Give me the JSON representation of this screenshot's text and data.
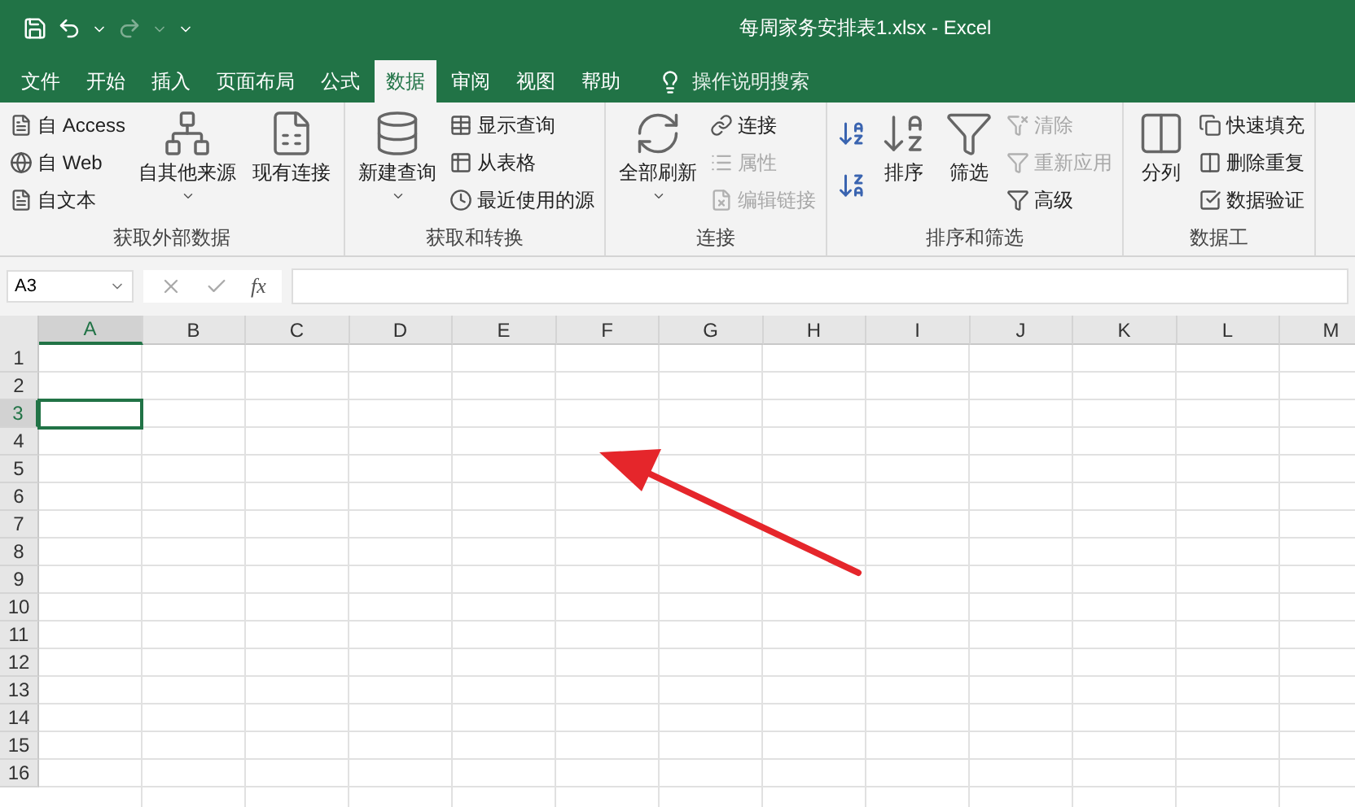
{
  "window": {
    "title": "每周家务安排表1.xlsx  -  Excel"
  },
  "tabs": [
    {
      "label": "文件",
      "selected": false
    },
    {
      "label": "开始",
      "selected": false
    },
    {
      "label": "插入",
      "selected": false
    },
    {
      "label": "页面布局",
      "selected": false
    },
    {
      "label": "公式",
      "selected": false
    },
    {
      "label": "数据",
      "selected": true
    },
    {
      "label": "审阅",
      "selected": false
    },
    {
      "label": "视图",
      "selected": false
    },
    {
      "label": "帮助",
      "selected": false
    }
  ],
  "search": {
    "placeholder": "操作说明搜索"
  },
  "ribbon": [
    {
      "label": "获取外部数据",
      "items": [
        {
          "kind": "stack",
          "items": [
            {
              "label": "自 Access",
              "disabled": false
            },
            {
              "label": "自 Web",
              "disabled": false
            },
            {
              "label": "自文本",
              "disabled": false
            }
          ]
        },
        {
          "kind": "large",
          "label": "自其他来源",
          "dropdown": true
        },
        {
          "kind": "large",
          "label": "现有连接",
          "dropdown": false
        }
      ]
    },
    {
      "label": "获取和转换",
      "items": [
        {
          "kind": "large",
          "label": "新建查询",
          "dropdown": true
        },
        {
          "kind": "stack",
          "items": [
            {
              "label": "显示查询",
              "disabled": false
            },
            {
              "label": "从表格",
              "disabled": false
            },
            {
              "label": "最近使用的源",
              "disabled": false
            }
          ]
        }
      ]
    },
    {
      "label": "连接",
      "items": [
        {
          "kind": "large",
          "label": "全部刷新",
          "dropdown": true
        },
        {
          "kind": "stack",
          "items": [
            {
              "label": "连接",
              "disabled": false
            },
            {
              "label": "属性",
              "disabled": true
            },
            {
              "label": "编辑链接",
              "disabled": true
            }
          ]
        }
      ]
    },
    {
      "label": "排序和筛选",
      "items": [
        {
          "kind": "sorticons"
        },
        {
          "kind": "large",
          "label": "排序",
          "dropdown": false
        },
        {
          "kind": "large",
          "label": "筛选",
          "dropdown": false
        },
        {
          "kind": "stack",
          "items": [
            {
              "label": "清除",
              "disabled": true
            },
            {
              "label": "重新应用",
              "disabled": true
            },
            {
              "label": "高级",
              "disabled": false
            }
          ]
        }
      ]
    },
    {
      "label": "数据工",
      "items": [
        {
          "kind": "large",
          "label": "分列",
          "dropdown": false
        },
        {
          "kind": "stack",
          "items": [
            {
              "label": "快速填充",
              "disabled": false
            },
            {
              "label": "删除重复",
              "disabled": false
            },
            {
              "label": "数据验证",
              "disabled": false
            }
          ]
        }
      ]
    }
  ],
  "name_box": {
    "value": "A3"
  },
  "formula_bar": {
    "fx": "fx"
  },
  "columns": [
    {
      "label": "A",
      "selected": true
    },
    {
      "label": "B",
      "selected": false
    },
    {
      "label": "C",
      "selected": false
    },
    {
      "label": "D",
      "selected": false
    },
    {
      "label": "E",
      "selected": false
    },
    {
      "label": "F",
      "selected": false
    },
    {
      "label": "G",
      "selected": false
    },
    {
      "label": "H",
      "selected": false
    },
    {
      "label": "I",
      "selected": false
    },
    {
      "label": "J",
      "selected": false
    },
    {
      "label": "K",
      "selected": false
    },
    {
      "label": "L",
      "selected": false
    },
    {
      "label": "M",
      "selected": false
    }
  ],
  "rows": [
    {
      "label": "1",
      "selected": false
    },
    {
      "label": "2",
      "selected": false
    },
    {
      "label": "3",
      "selected": true
    },
    {
      "label": "4",
      "selected": false
    },
    {
      "label": "5",
      "selected": false
    },
    {
      "label": "6",
      "selected": false
    },
    {
      "label": "7",
      "selected": false
    },
    {
      "label": "8",
      "selected": false
    },
    {
      "label": "9",
      "selected": false
    },
    {
      "label": "10",
      "selected": false
    },
    {
      "label": "11",
      "selected": false
    },
    {
      "label": "12",
      "selected": false
    },
    {
      "label": "13",
      "selected": false
    },
    {
      "label": "14",
      "selected": false
    },
    {
      "label": "15",
      "selected": false
    },
    {
      "label": "16",
      "selected": false
    }
  ],
  "annotation": {
    "kind": "arrow"
  }
}
